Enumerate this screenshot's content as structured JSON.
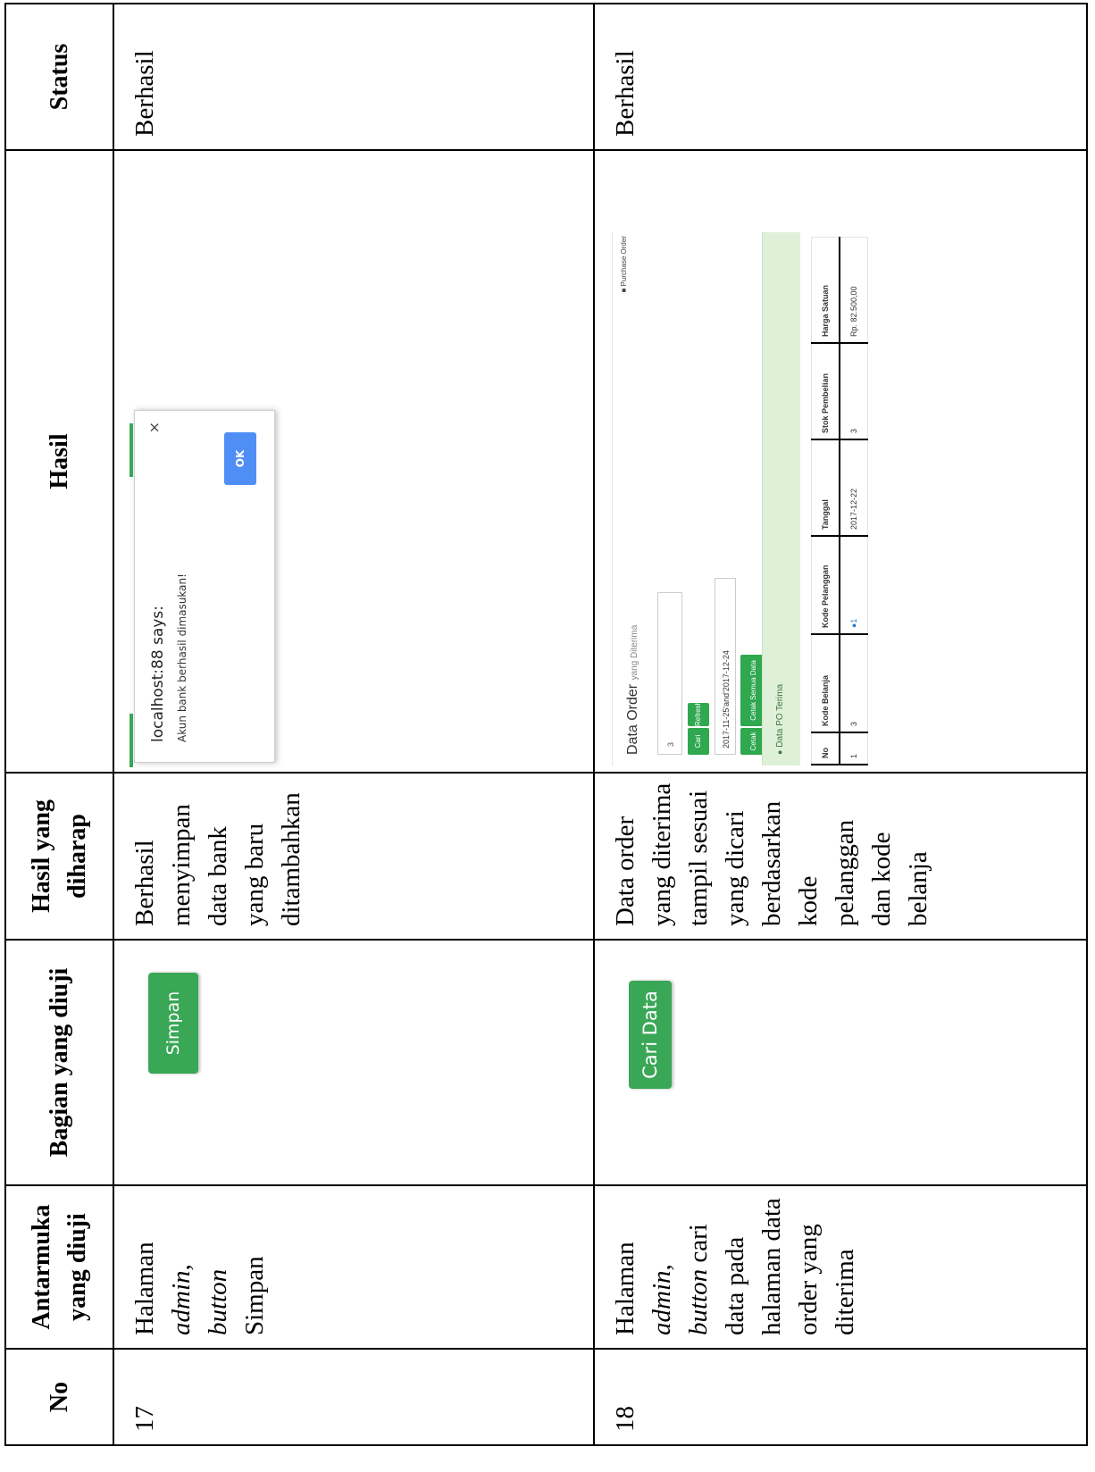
{
  "table": {
    "headers": {
      "no": "No",
      "antarmuka": "Antarmuka yang diuji",
      "bagian": "Bagian yang diuji",
      "hasil_harap": "Hasil yang diharap",
      "hasil": "Hasil",
      "status": "Status"
    },
    "rows": [
      {
        "no": "17",
        "antarmuka": {
          "t1": "Halaman",
          "t2": "admin,",
          "t3": "button",
          "t4": "Simpan"
        },
        "bagian_button": "Simpan",
        "hasil_harap": "Berhasil menyimpan data bank yang baru ditambahkan",
        "status": "Berhasil",
        "dialog": {
          "title": "localhost:88 says:",
          "message": "Akun bank berhasil dimasukan!",
          "close": "×",
          "ok": "OK"
        }
      },
      {
        "no": "18",
        "antarmuka": {
          "t1": "Halaman",
          "t2": "admin,",
          "t3": "button",
          "t4": "cari data pada halaman data order yang diterima"
        },
        "bagian_button": "Cari Data",
        "hasil_harap": "Data order yang diterima tampil sesuai yang dicari berdasarkan kode pelanggan dan kode belanja",
        "status": "Berhasil",
        "order_screen": {
          "title": "Data Order",
          "subtitle": "yang Diterima",
          "breadcrumb": "Purchase Order",
          "search_value": "3",
          "btn_cari": "Cari Data",
          "btn_refresh": "Refresh",
          "date_range": "2017-11-25'and'2017-12-24",
          "btn_cetak": "Cetak",
          "btn_cetak_semua": "Cetak Semua Data Orderan",
          "section_label": "Data PO Terima",
          "columns": [
            "No",
            "Kode Belanja",
            "Kode Pelanggan",
            "Tanggal",
            "Stok Pembelian",
            "Harga Satuan"
          ],
          "row": [
            "1",
            "3",
            "1",
            "2017-12-22",
            "3",
            "Rp. 82.500,00"
          ]
        }
      }
    ]
  }
}
